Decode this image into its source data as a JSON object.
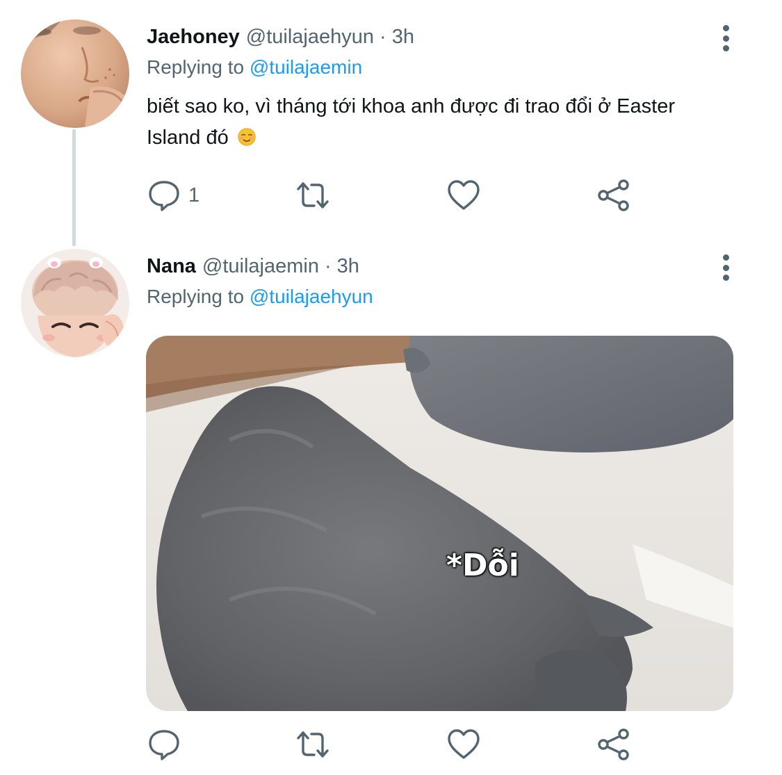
{
  "thread": [
    {
      "author": {
        "display_name": "Jaehoney",
        "handle": "@tuilajaehyun",
        "avatar_icon": "person-avatar"
      },
      "timestamp": "3h",
      "separator": "·",
      "replying_to": {
        "prefix": "Replying to",
        "handle": "@tuilajaemin"
      },
      "text": "biết sao ko, vì tháng tới khoa anh được đi trao đổi ở Easter Island đó",
      "emoji": "smiling-face-icon",
      "actions": {
        "reply_count": "1",
        "retweet_count": "",
        "like_count": ""
      }
    },
    {
      "author": {
        "display_name": "Nana",
        "handle": "@tuilajaemin",
        "avatar_icon": "person-avatar"
      },
      "timestamp": "3h",
      "separator": "·",
      "replying_to": {
        "prefix": "Replying to",
        "handle": "@tuilajaehyun"
      },
      "media": {
        "caption": "*Dỗi",
        "description_icon": "grey-cat-image"
      },
      "actions": {
        "reply_count": "",
        "retweet_count": "",
        "like_count": ""
      }
    }
  ],
  "colors": {
    "text_primary": "#0f1419",
    "text_secondary": "#536471",
    "link": "#1d9bf0",
    "thread_line": "#cfd9de"
  }
}
